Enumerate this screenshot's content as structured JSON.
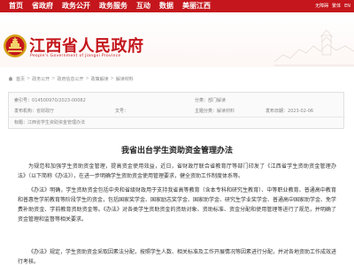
{
  "topnav": {
    "items": [
      "首页",
      "省政府",
      "政务公开",
      "政务服务",
      "互动",
      "数据",
      "美丽江西"
    ],
    "right": [
      "无障碍",
      "繁体",
      "EN"
    ]
  },
  "header": {
    "title": "江西省人民政府",
    "subtitle": "People's Government of Jiangxi Province"
  },
  "breadcrumb": [
    "首页",
    "政务公开",
    "政府信息公开",
    "政策解读",
    "解读材料"
  ],
  "meta": {
    "index_label": "索引号：",
    "index_value": "014500970/2023-00082",
    "category_label": "分类：",
    "category_value": "部门解读",
    "issuer_label": "发布机构：",
    "issuer_value": "省财政厅",
    "doc_no_label": "文号：",
    "doc_no_value": "",
    "topic_label": "主题分类：",
    "topic_value": "解读材料",
    "date_label": "发布日期：",
    "date_value": "2023-02-06",
    "title_label": "标题：",
    "title_value": "江西省学生资助资金管理办法"
  },
  "article": {
    "title": "我省出台学生资助资金管理办法",
    "para1": "为规范和加强学生资助资金管理，提高资金使用效益，近日，省财政厅联合省教育厅等部门印发了《江西省学生资助资金管理办法》（以下简称《办法》），在进一步明确学生资助资金使用管理要求，健全资助工作制度体系等。",
    "para2": "《办法》明确，学生资助资金包括中央和省级财政用于支持我省高等教育（含本专科和研究生教育）、中等职业教育、普通高中教育和普惠性学前教育等阶段学生的资金，包括国家奖学金、国家励志奖学金、国家助学金、研究生学业奖学金、普通高中国家助学金、免学费补助资金、学前教育资助资金等。《办法》对各类学生资助资金的资助对象、资助标准、资金分配和使用管理等进行了规范，并明确了资金管理和监督等相关要求。",
    "para3": "《办法》规定，学生资助资金采取因素法分配，按照学生人数、相关标准及工作开展情况等因素进行分配，并对各地资助工作成效进行考核。"
  },
  "colors": {
    "brand_red": "#c4161c",
    "text": "#333333"
  },
  "icons": [
    "emblem-icon",
    "home-icon",
    "skyline-illustration"
  ]
}
